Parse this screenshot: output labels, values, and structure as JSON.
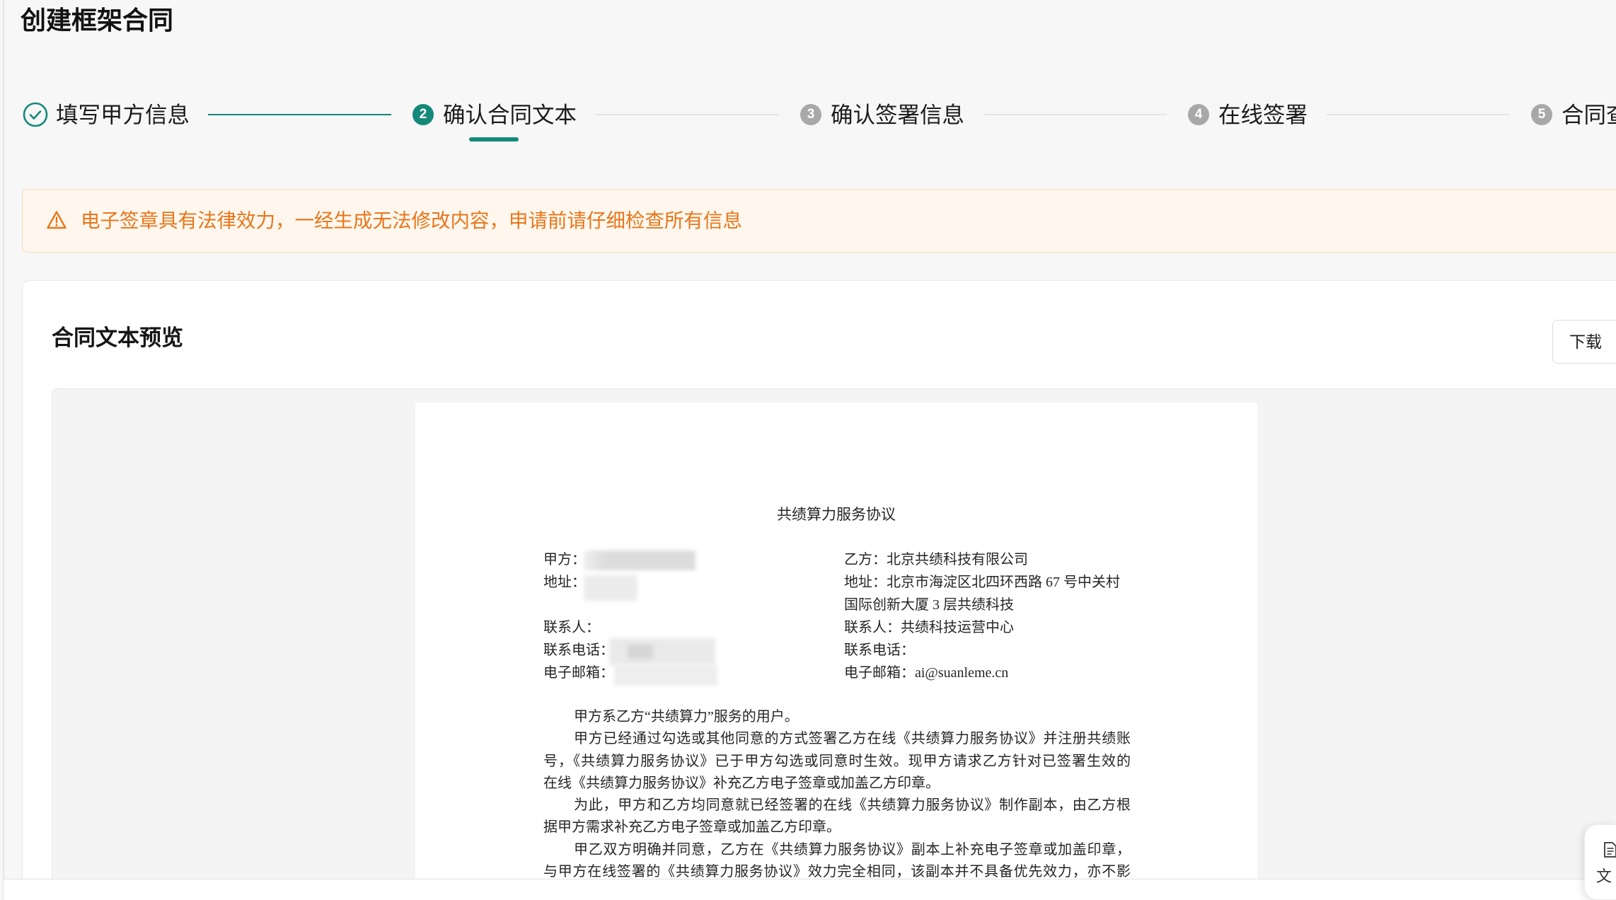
{
  "page": {
    "title": "创建框架合同"
  },
  "colors": {
    "primary": "#14897a",
    "warning_text": "#e8761a",
    "warning_background": "#fff7ee",
    "step_inactive": "#a8a8a8"
  },
  "steps": {
    "current_step": 2,
    "items": [
      {
        "label": "填写甲方信息",
        "icon": "check-circle-icon"
      },
      {
        "number": "2",
        "label": "确认合同文本"
      },
      {
        "number": "3",
        "label": "确认签署信息"
      },
      {
        "number": "4",
        "label": "在线签署"
      },
      {
        "number": "5",
        "label": "合同查"
      }
    ]
  },
  "warning": {
    "icon": "warning-triangle-icon",
    "text": "电子签章具有法律效力，一经生成无法修改内容，申请前请仔细检查所有信息"
  },
  "preview": {
    "title": "合同文本预览",
    "download_label": "下载",
    "document": {
      "title": "共绩算力服务协议",
      "party_a": {
        "name_label": "甲方：",
        "address_label": "地址：",
        "contact_label": "联系人：",
        "phone_label": "联系电话：",
        "email_label": "电子邮箱："
      },
      "party_b": {
        "name": "乙方：北京共绩科技有限公司",
        "address_line_1": "地址：北京市海淀区北四环西路 67 号中关村",
        "address_line_2": "国际创新大厦 3 层共绩科技",
        "contact": "联系人：共绩科技运营中心",
        "phone": "联系电话：",
        "email": "电子邮箱：ai@suanleme.cn"
      },
      "body_lines": [
        "甲方系乙方“共绩算力”服务的用户。",
        "甲方已经通过勾选或其他同意的方式签署乙方在线《共绩算力服务协议》并注册共绩账",
        "号，《共绩算力服务协议》已于甲方勾选或同意时生效。现甲方请求乙方针对已签署生效的",
        "在线《共绩算力服务协议》补充乙方电子签章或加盖乙方印章。",
        "为此，甲方和乙方均同意就已经签署的在线《共绩算力服务协议》制作副本，由乙方根",
        "据甲方需求补充乙方电子签章或加盖乙方印章。",
        "甲乙双方明确并同意，乙方在《共绩算力服务协议》副本上补充电子签章或加盖印章，",
        "与甲方在线签署的《共绩算力服务协议》效力完全相同，该副本并不具备优先效力，亦不影"
      ]
    }
  },
  "side_widget": {
    "icon": "document-icon",
    "label": "文"
  }
}
